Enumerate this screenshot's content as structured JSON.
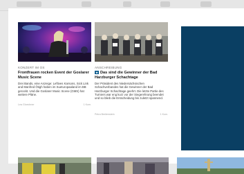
{
  "articles": [
    {
      "kicker": "KONZERT IM OS",
      "headline": "Frontfrauen rocken Event der Goslarer Music Scene",
      "teaser": "Drei Bands, eine Anzeige: Leftives Karsons, Sick Link and Manfred Ötigh haben im Sueturopaaland im BB gerockt. Und die Goslarer Music Scene (GMS) hat weitere Pläne.",
      "source": "Lea Gloechner",
      "comments": "1 Kom."
    },
    {
      "kicker": "ANSCHREIBUNG",
      "badge": "★",
      "headline": "Das sind die Gewinner der Bad Harzburger Schachtage",
      "teaser": "Der Präsident des Niedersächsischen Schachverbandes hat die Gewinner der Bad Harzburger Schachtage geehrt. Die letzte Partie des Turniers war eng kurz vor der Siegerehrung beendet und so blieb die Entscheidung bis zuletzt spannend.",
      "source": "Petra Breitenstein",
      "comments": "1 Kom."
    }
  ],
  "colors": {
    "ad": "#0a3f63",
    "badge": "#0b5b8c"
  }
}
